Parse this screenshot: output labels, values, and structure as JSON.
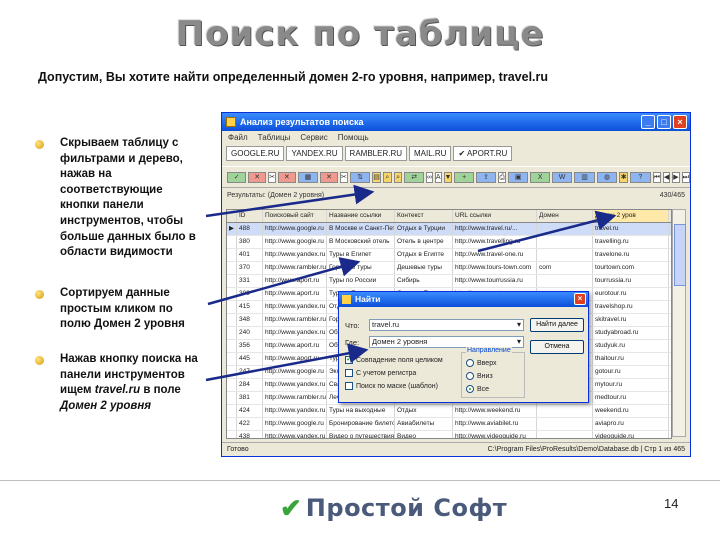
{
  "slide": {
    "title": "Поиск по таблице",
    "subtitle": "Допустим, Вы хотите найти определенный домен 2-го уровня, например, travel.ru",
    "bullets": [
      {
        "lines": [
          "Скрываем таблицу с",
          "фильтрами и дерево,",
          "нажав на",
          "соответствующие",
          "кнопки панели",
          "инструментов, чтобы",
          "больше данных было в",
          "области видимости"
        ]
      },
      {
        "lines": [
          "Сортируем данные",
          "простым кликом по",
          "полю Домен 2 уровня"
        ]
      },
      {
        "lines": [
          "Нажав кнопку поиска на",
          "панели инструментов",
          "ищем"
        ],
        "italic_1": "travel.ru",
        "mid": "в поле",
        "italic_2": "Домен 2 уровня"
      }
    ],
    "page_number": "14",
    "logo_text": "Простой Софт"
  },
  "window": {
    "title": "Анализ результатов поиска",
    "menu": [
      "Файл",
      "Таблицы",
      "Сервис",
      "Помощь"
    ],
    "tabs": [
      "GOOGLE.RU",
      "YANDEX.RU",
      "RAMBLER.RU",
      "MAIL.RU",
      "✔ APORT.RU"
    ],
    "info_left": "Результаты: (Домен 2 уровня)",
    "info_right": "430/465",
    "columns": [
      "",
      "ID",
      "Поисковый сайт",
      "Название ссылки",
      "Контекст",
      "URL ссылки",
      "Домен",
      "Домен 2 уров"
    ],
    "rows": [
      [
        "▶",
        "488",
        "http://www.google.ru",
        "В Москве и Санкт-Петербурге",
        "Отдых в Турции",
        "http://www.travel.ru/...",
        "",
        "travel.ru"
      ],
      [
        "",
        "380",
        "http://www.google.ru",
        "В Московский отель",
        "Отель в центре",
        "http://www.travelling.ru",
        "",
        "travelling.ru"
      ],
      [
        "",
        "401",
        "http://www.yandex.ru",
        "Туры в Египет",
        "Отдых в Египте",
        "http://www.travel-one.ru",
        "",
        "travelone.ru"
      ],
      [
        "",
        "370",
        "http://www.rambler.ru",
        "Горящие туры",
        "Дешевые туры",
        "http://www.tours-town.com",
        "com",
        "tourtown.com"
      ],
      [
        "",
        "331",
        "http://www.aport.ru",
        "Туры по России",
        "Сибирь",
        "http://www.tourrussia.ru",
        "",
        "tourrussia.ru"
      ],
      [
        "",
        "309",
        "http://www.aport.ru",
        "Туры в Европу",
        "Отдых в Европе",
        "http://www.eurotour.ru",
        "",
        "eurotour.ru"
      ],
      [
        "",
        "415",
        "http://www.yandex.ru",
        "Отдых летом",
        "Морские круизы",
        "http://www.travelshop.ru",
        "",
        "travelshop.ru"
      ],
      [
        "",
        "348",
        "http://www.rambler.ru",
        "Горнолыжные курорты",
        "Альпы",
        "http://www.ski-travel.ru",
        "",
        "skitravel.ru"
      ],
      [
        "",
        "240",
        "http://www.yandex.ru",
        "Образование за рубежом",
        "Учеба",
        "http://www.studyabroad.ru",
        "",
        "studyabroad.ru"
      ],
      [
        "",
        "356",
        "http://www.aport.ru",
        "Обучение в Англии",
        "Языковые курсы",
        "http://www.study-en.ru",
        "",
        "studyuk.ru"
      ],
      [
        "",
        "445",
        "http://www.aport.ru",
        "Туры в Таиланд",
        "Экзотика",
        "http://www.thai-tour.ru",
        "",
        "thaitour.ru"
      ],
      [
        "",
        "247",
        "http://www.google.ru",
        "Экскурсии",
        "Город",
        "http://www.gotour.ru",
        "",
        "gotour.ru"
      ],
      [
        "",
        "284",
        "http://www.yandex.ru",
        "Свадебные туры",
        "Путешествия",
        "http://www.mytour.ru",
        "",
        "mytour.ru"
      ],
      [
        "",
        "381",
        "http://www.rambler.ru",
        "Лечебные туры",
        "Санатории",
        "http://www.med-tour.ru",
        "",
        "medtour.ru"
      ],
      [
        "",
        "424",
        "http://www.yandex.ru",
        "Туры на выходные",
        "Отдых",
        "http://www.weekend.ru",
        "",
        "weekend.ru"
      ],
      [
        "",
        "422",
        "http://www.google.ru",
        "Бронирование билетов",
        "Авиабилеты",
        "http://www.aviabilet.ru",
        "",
        "aviapro.ru"
      ],
      [
        "",
        "438",
        "http://www.yandex.ru",
        "Видео о путешествиях",
        "Видео",
        "http://www.videoguide.ru",
        "",
        "videoguide.ru"
      ],
      [
        "",
        "405",
        "http://www.rambler.ru",
        "Отдых на море",
        "Пляжи",
        "http://www.seatour.ru",
        "",
        "seatour.ru"
      ],
      [
        "",
        "480",
        "http://www.rambler.ru",
        "Туры в Грецию",
        "Греция",
        "http://www.greece-tour.ru",
        "",
        "grtour.ru"
      ],
      [
        "",
        "443",
        "http://www.aport.ru",
        "Туры в Италию",
        "Италия",
        "http://www.italy-tour.ru",
        "",
        "vinograd.ru"
      ],
      [
        "",
        "478",
        "http://www.aport.ru",
        "Бесплатные путевки",
        "Акции",
        "http://www.vip-concert.ru",
        "",
        "vip-concert.ru"
      ],
      [
        "",
        "478",
        "http://www.rambler.ru",
        "Бесплатные отели",
        "Путеводитель",
        "http://www.offtour.ru",
        "",
        "offtour.ru"
      ],
      [
        "",
        "486",
        "http://www.google.ru",
        "Бесплатно и без",
        "Отдых в стране",
        "http://www.skitrail.ru",
        "",
        "skitrailing.ru"
      ],
      [
        "",
        "408",
        "http://www.rambler.ru",
        "Туры по Москве",
        "Москва",
        "http://www.moscowtour.ru",
        "",
        "moscowtour.ru"
      ]
    ],
    "status_left": "Готово",
    "status_right": "C:\\Program Files\\ProResults\\Demo\\Database.db | Стр 1 из 465"
  },
  "find_dialog": {
    "title": "Найти",
    "what_label": "Что:",
    "what_value": "travel.ru",
    "where_label": "Где:",
    "where_value": "Домен 2 уровня",
    "find_next": "Найти далее",
    "cancel": "Отмена",
    "checkboxes": [
      {
        "label": "Совпадение поля целиком",
        "checked": true
      },
      {
        "label": "С учетом регистра",
        "checked": false
      },
      {
        "label": "Поиск по маске (шаблон)",
        "checked": false
      }
    ],
    "direction_label": "Направление",
    "directions": [
      {
        "label": "Вверх",
        "selected": false
      },
      {
        "label": "Вниз",
        "selected": false
      },
      {
        "label": "Все",
        "selected": true
      }
    ]
  },
  "colors": {
    "title_gray": "#8a8a8a",
    "xp_blue": "#0a4fd8",
    "bullet_gold": "#d49a10",
    "arrow": "#1a2a8a",
    "logo_green": "#3aa33a"
  }
}
